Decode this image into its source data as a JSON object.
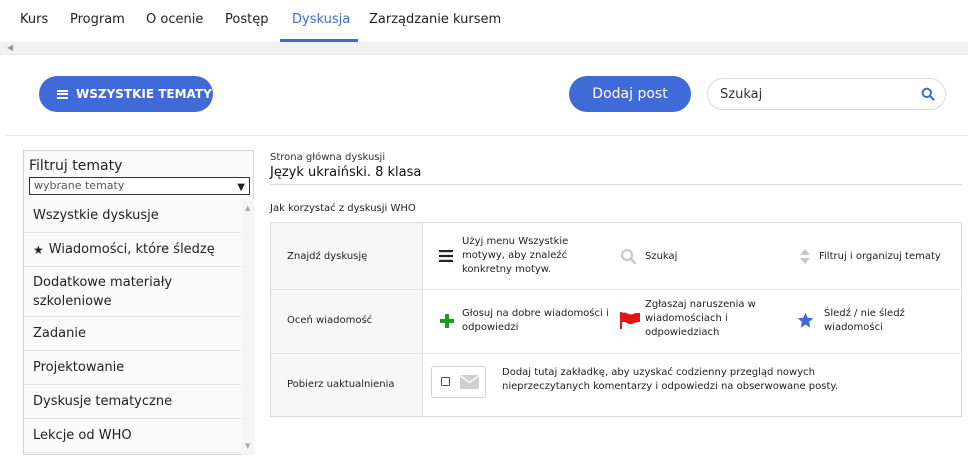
{
  "nav": {
    "tabs": [
      "Kurs",
      "Program",
      "O ocenie",
      "Postęp",
      "Dyskusja",
      "Zarządzanie kursem"
    ],
    "active_tab": "Dyskusja",
    "accent_color": "#3f6ad8"
  },
  "toolbar": {
    "all_topics_label": "WSZYSTKIE TEMATY",
    "add_post_label": "Dodaj post",
    "search_value": "Szukaj"
  },
  "filter": {
    "title": "Filtruj tematy",
    "select_value": "wybrane tematy",
    "items": [
      "Wszystkie dyskusje",
      "Wiadomości, które śledzę",
      "Dodatkowe materiały szkoleniowe",
      "Zadanie",
      "Projektowanie",
      "Dyskusje tematyczne",
      "Lekcje od WHO"
    ]
  },
  "main": {
    "breadcrumb": "Strona główna dyskusji",
    "course_title": "Język ukraiński. 8 klasa",
    "howto_heading": "Jak korzystać z dyskusji WHO",
    "rows": {
      "find": {
        "label": "Znajdź dyskusję",
        "menu_hint": "Użyj menu Wszystkie motywy, aby znaleźć konkretny motyw.",
        "search_hint": "Szukaj",
        "filter_hint": "Filtruj i organizuj tematy"
      },
      "rate": {
        "label": "Oceń wiadomość",
        "vote_hint": "Głosuj na dobre wiadomości i odpowiedzi",
        "report_hint": "Zgłaszaj naruszenia w wiadomościach i odpowiedziach",
        "follow_hint": "Śledź / nie śledź wiadomości"
      },
      "updates": {
        "label": "Pobierz uaktualnienia",
        "digest_hint": "Dodaj tutaj zakładkę, aby uzyskać codzienny przegląd nowych nieprzeczytanych komentarzy i odpowiedzi na obserwowane posty."
      }
    }
  },
  "icons": {
    "menu": "menu-icon",
    "search": "search-icon",
    "sort": "sort-icon",
    "plus": "plus-icon",
    "flag": "flag-icon",
    "star": "star-icon",
    "mail": "mail-icon"
  },
  "colors": {
    "plus": "#1f9d1f",
    "flag": "#e01515",
    "star": "#3f6ad8"
  }
}
